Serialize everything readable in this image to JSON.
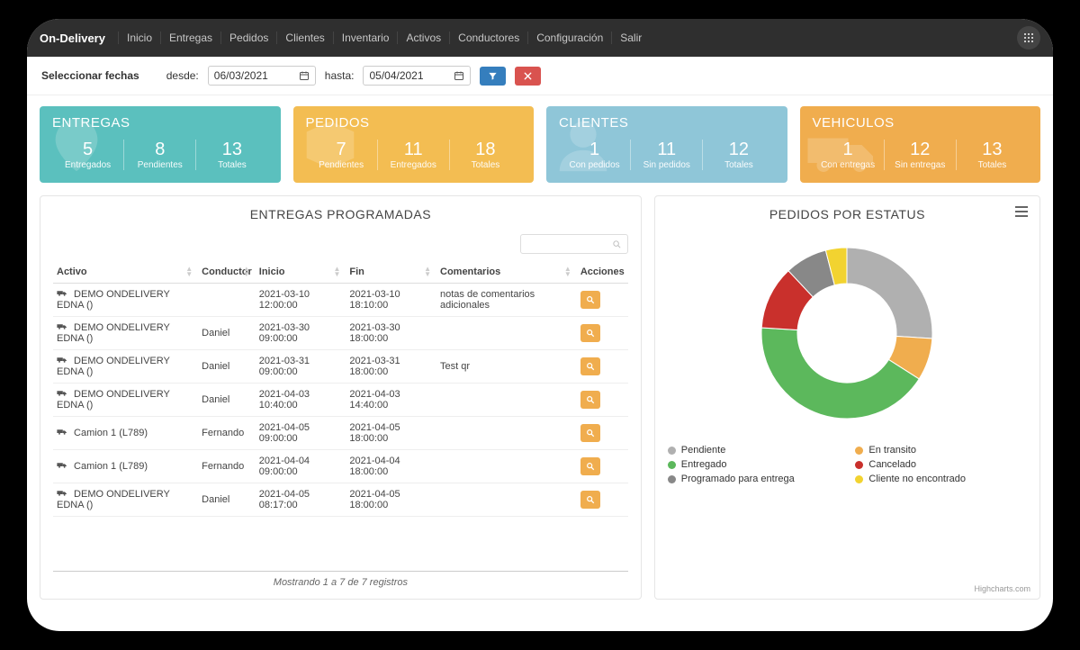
{
  "nav": {
    "brand": "On-Delivery",
    "items": [
      "Inicio",
      "Entregas",
      "Pedidos",
      "Clientes",
      "Inventario",
      "Activos",
      "Conductores",
      "Configuración",
      "Salir"
    ]
  },
  "filters": {
    "title": "Seleccionar fechas",
    "from_label": "desde:",
    "from_value": "06/03/2021",
    "to_label": "hasta:",
    "to_value": "05/04/2021"
  },
  "cards": [
    {
      "title": "ENTREGAS",
      "items": [
        {
          "n": "5",
          "l": "Entregados"
        },
        {
          "n": "8",
          "l": "Pendientes"
        },
        {
          "n": "13",
          "l": "Totales"
        }
      ]
    },
    {
      "title": "PEDIDOS",
      "items": [
        {
          "n": "7",
          "l": "Pendientes"
        },
        {
          "n": "11",
          "l": "Entregados"
        },
        {
          "n": "18",
          "l": "Totales"
        }
      ]
    },
    {
      "title": "CLIENTES",
      "items": [
        {
          "n": "1",
          "l": "Con pedidos"
        },
        {
          "n": "11",
          "l": "Sin pedidos"
        },
        {
          "n": "12",
          "l": "Totales"
        }
      ]
    },
    {
      "title": "VEHICULOS",
      "items": [
        {
          "n": "1",
          "l": "Con entregas"
        },
        {
          "n": "12",
          "l": "Sin entregas"
        },
        {
          "n": "13",
          "l": "Totales"
        }
      ]
    }
  ],
  "table": {
    "title": "ENTREGAS PROGRAMADAS",
    "headers": [
      "Activo",
      "Conductor",
      "Inicio",
      "Fin",
      "Comentarios",
      "Acciones"
    ],
    "rows": [
      {
        "activo": "DEMO ONDELIVERY EDNA ()",
        "conductor": "",
        "inicio": "2021-03-10 12:00:00",
        "fin": "2021-03-10 18:10:00",
        "comentarios": "notas de comentarios adicionales"
      },
      {
        "activo": "DEMO ONDELIVERY EDNA ()",
        "conductor": "Daniel",
        "inicio": "2021-03-30 09:00:00",
        "fin": "2021-03-30 18:00:00",
        "comentarios": ""
      },
      {
        "activo": "DEMO ONDELIVERY EDNA ()",
        "conductor": "Daniel",
        "inicio": "2021-03-31 09:00:00",
        "fin": "2021-03-31 18:00:00",
        "comentarios": "Test qr"
      },
      {
        "activo": "DEMO ONDELIVERY EDNA ()",
        "conductor": "Daniel",
        "inicio": "2021-04-03 10:40:00",
        "fin": "2021-04-03 14:40:00",
        "comentarios": ""
      },
      {
        "activo": "Camion 1 (L789)",
        "conductor": "Fernando",
        "inicio": "2021-04-05 09:00:00",
        "fin": "2021-04-05 18:00:00",
        "comentarios": ""
      },
      {
        "activo": "Camion 1 (L789)",
        "conductor": "Fernando",
        "inicio": "2021-04-04 09:00:00",
        "fin": "2021-04-04 18:00:00",
        "comentarios": ""
      },
      {
        "activo": "DEMO ONDELIVERY EDNA ()",
        "conductor": "Daniel",
        "inicio": "2021-04-05 08:17:00",
        "fin": "2021-04-05 18:00:00",
        "comentarios": ""
      }
    ],
    "footer": "Mostrando 1 a 7 de 7 registros"
  },
  "chart": {
    "title": "PEDIDOS POR ESTATUS",
    "legend": [
      {
        "label": "Pendiente",
        "color": "#b0b0b0"
      },
      {
        "label": "En transito",
        "color": "#f0ad4e"
      },
      {
        "label": "Entregado",
        "color": "#5cb85c"
      },
      {
        "label": "Cancelado",
        "color": "#c9302c"
      },
      {
        "label": "Programado para entrega",
        "color": "#888888"
      },
      {
        "label": "Cliente no encontrado",
        "color": "#f2d330"
      }
    ],
    "credit": "Highcharts.com"
  },
  "chart_data": {
    "type": "pie",
    "title": "PEDIDOS POR ESTATUS",
    "series": [
      {
        "name": "Pendiente",
        "value": 26,
        "color": "#b0b0b0"
      },
      {
        "name": "En transito",
        "value": 8,
        "color": "#f0ad4e"
      },
      {
        "name": "Entregado",
        "value": 42,
        "color": "#5cb85c"
      },
      {
        "name": "Cancelado",
        "value": 12,
        "color": "#c9302c"
      },
      {
        "name": "Programado para entrega",
        "value": 8,
        "color": "#888888"
      },
      {
        "name": "Cliente no encontrado",
        "value": 4,
        "color": "#f2d330"
      }
    ]
  }
}
